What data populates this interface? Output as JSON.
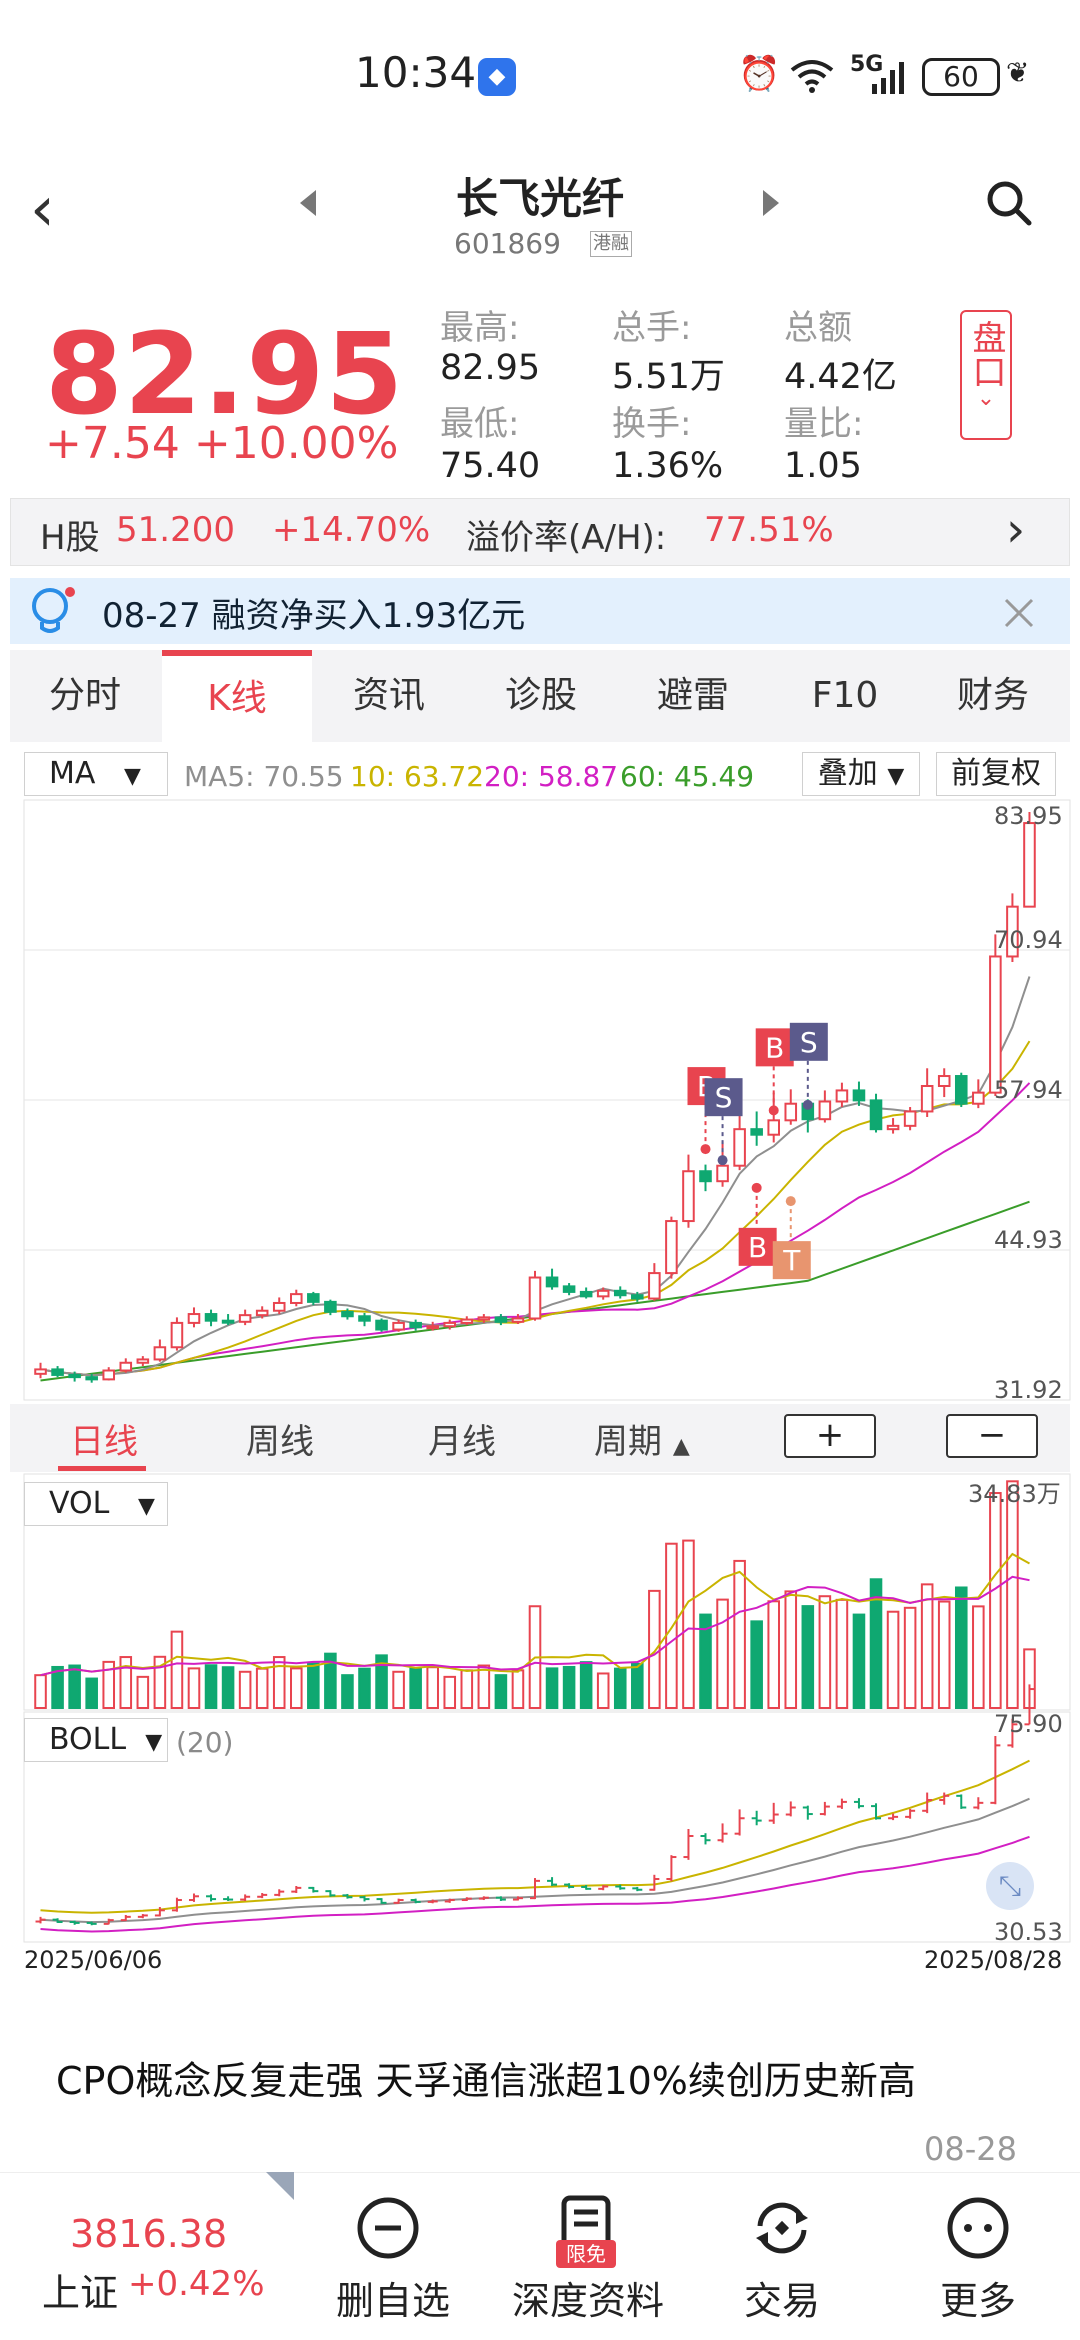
{
  "status_bar": {
    "time": "10:34",
    "right": "5G",
    "battery": "60"
  },
  "header": {
    "name": "长飞光纤",
    "code": "601869",
    "tag": "港融"
  },
  "quote": {
    "price": "82.95",
    "change": "+7.54",
    "change_pct": "+10.00%",
    "stats": [
      {
        "label": "最高:",
        "value": "82.95"
      },
      {
        "label": "总手:",
        "value": "5.51万"
      },
      {
        "label": "总额",
        "value": "4.42亿"
      },
      {
        "label": "最低:",
        "value": "75.40"
      },
      {
        "label": "换手:",
        "value": "1.36%"
      },
      {
        "label": "量比:",
        "value": "1.05"
      }
    ],
    "pankou": "盘口"
  },
  "hk": {
    "label": "H股",
    "price": "51.200",
    "pct": "+14.70%",
    "premium_label": "溢价率(A/H):",
    "premium_val": "77.51%"
  },
  "notice": {
    "text": "08-27 融资净买入1.93亿元"
  },
  "tabs": [
    "分时",
    "K线",
    "资讯",
    "诊股",
    "避雷",
    "F10",
    "财务"
  ],
  "indicator_bar": {
    "ma_select": "MA",
    "ma5": "MA5: 70.55",
    "ma10": "10: 63.72",
    "ma20": "20: 58.87",
    "ma60": "60: 45.49",
    "overlay": "叠加",
    "adjust": "前复权"
  },
  "chart_labels": {
    "ticks": [
      "83.95",
      "70.94",
      "57.94",
      "44.93",
      "31.92"
    ],
    "vol_select": "VOL",
    "vol_max": "34.83万",
    "boll_select": "BOLL",
    "boll_param": "(20)",
    "boll_top": "75.90",
    "boll_bottom": "30.53",
    "date_start": "2025/06/06",
    "date_end": "2025/08/28",
    "markers": {
      "b": "B",
      "s": "S",
      "t": "T"
    }
  },
  "periods": [
    "日线",
    "周线",
    "月线",
    "周期"
  ],
  "zoom": {
    "plus": "+",
    "minus": "−"
  },
  "news": {
    "title": "CPO概念反复走强 天孚通信涨超10%续创历史新高",
    "date": "08-28"
  },
  "bottom": {
    "index_value": "3816.38",
    "index_name": "上证",
    "index_change": "+0.42%",
    "items": [
      "删自选",
      "深度资料",
      "交易",
      "更多"
    ],
    "badge": "限免"
  },
  "colors": {
    "up": "#e8444f",
    "down": "#0fa871",
    "ma5": "#8f8f8f",
    "ma10": "#c9b400",
    "ma20": "#d21fc3",
    "ma60": "#3a9d2a"
  },
  "chart_data": {
    "type": "candlestick",
    "y_range": [
      31.92,
      83.95
    ],
    "x_range": [
      "2025/06/06",
      "2025/08/28"
    ],
    "candles": [
      {
        "o": 33.2,
        "c": 33.6,
        "h": 34.2,
        "l": 32.8
      },
      {
        "o": 33.6,
        "c": 33.1,
        "h": 33.9,
        "l": 32.9
      },
      {
        "o": 33.1,
        "c": 32.9,
        "h": 33.4,
        "l": 32.5
      },
      {
        "o": 32.9,
        "c": 32.7,
        "h": 33.2,
        "l": 32.4
      },
      {
        "o": 32.7,
        "c": 33.5,
        "h": 33.8,
        "l": 32.6
      },
      {
        "o": 33.5,
        "c": 34.2,
        "h": 34.6,
        "l": 33.3
      },
      {
        "o": 34.2,
        "c": 34.5,
        "h": 34.8,
        "l": 33.9
      },
      {
        "o": 34.5,
        "c": 35.6,
        "h": 36.3,
        "l": 34.3
      },
      {
        "o": 35.6,
        "c": 37.8,
        "h": 38.3,
        "l": 35.3
      },
      {
        "o": 37.8,
        "c": 38.6,
        "h": 39.2,
        "l": 37.4
      },
      {
        "o": 38.6,
        "c": 38.0,
        "h": 39.0,
        "l": 37.5
      },
      {
        "o": 38.0,
        "c": 37.9,
        "h": 38.6,
        "l": 37.6
      },
      {
        "o": 37.9,
        "c": 38.5,
        "h": 39.0,
        "l": 37.6
      },
      {
        "o": 38.5,
        "c": 38.9,
        "h": 39.3,
        "l": 38.2
      },
      {
        "o": 38.9,
        "c": 39.6,
        "h": 40.1,
        "l": 38.6
      },
      {
        "o": 39.6,
        "c": 40.4,
        "h": 40.8,
        "l": 39.3
      },
      {
        "o": 40.4,
        "c": 39.7,
        "h": 40.6,
        "l": 39.4
      },
      {
        "o": 39.7,
        "c": 38.8,
        "h": 39.9,
        "l": 38.5
      },
      {
        "o": 38.8,
        "c": 38.4,
        "h": 39.1,
        "l": 38.1
      },
      {
        "o": 38.4,
        "c": 38.0,
        "h": 38.7,
        "l": 37.5
      },
      {
        "o": 38.0,
        "c": 37.2,
        "h": 38.2,
        "l": 37.0
      },
      {
        "o": 37.2,
        "c": 37.8,
        "h": 38.1,
        "l": 37.0
      },
      {
        "o": 37.8,
        "c": 37.4,
        "h": 38.1,
        "l": 37.1
      },
      {
        "o": 37.4,
        "c": 37.5,
        "h": 37.9,
        "l": 37.1
      },
      {
        "o": 37.5,
        "c": 37.8,
        "h": 38.1,
        "l": 37.2
      },
      {
        "o": 37.8,
        "c": 38.1,
        "h": 38.4,
        "l": 37.6
      },
      {
        "o": 38.1,
        "c": 38.3,
        "h": 38.6,
        "l": 37.8
      },
      {
        "o": 38.3,
        "c": 37.9,
        "h": 38.6,
        "l": 37.6
      },
      {
        "o": 37.9,
        "c": 38.2,
        "h": 38.6,
        "l": 37.7
      },
      {
        "o": 38.2,
        "c": 41.9,
        "h": 42.5,
        "l": 38.0
      },
      {
        "o": 41.9,
        "c": 41.1,
        "h": 42.7,
        "l": 40.8
      },
      {
        "o": 41.1,
        "c": 40.6,
        "h": 41.4,
        "l": 40.3
      },
      {
        "o": 40.6,
        "c": 40.2,
        "h": 41.0,
        "l": 40.0
      },
      {
        "o": 40.2,
        "c": 40.7,
        "h": 41.0,
        "l": 39.9
      },
      {
        "o": 40.7,
        "c": 40.3,
        "h": 41.1,
        "l": 40.0
      },
      {
        "o": 40.3,
        "c": 40.0,
        "h": 40.6,
        "l": 39.7
      },
      {
        "o": 40.0,
        "c": 42.3,
        "h": 43.2,
        "l": 39.8
      },
      {
        "o": 42.3,
        "c": 47.0,
        "h": 47.4,
        "l": 41.8
      },
      {
        "o": 47.0,
        "c": 51.5,
        "h": 53.0,
        "l": 46.4
      },
      {
        "o": 51.5,
        "c": 50.6,
        "h": 52.1,
        "l": 49.7
      },
      {
        "o": 50.6,
        "c": 52.0,
        "h": 54.2,
        "l": 50.1
      },
      {
        "o": 52.0,
        "c": 55.3,
        "h": 57.2,
        "l": 51.6
      },
      {
        "o": 55.3,
        "c": 54.8,
        "h": 56.9,
        "l": 53.8
      },
      {
        "o": 54.8,
        "c": 56.1,
        "h": 58.6,
        "l": 54.1
      },
      {
        "o": 56.1,
        "c": 57.6,
        "h": 58.9,
        "l": 55.7
      },
      {
        "o": 57.6,
        "c": 56.2,
        "h": 58.0,
        "l": 55.0
      },
      {
        "o": 56.2,
        "c": 57.8,
        "h": 58.8,
        "l": 55.9
      },
      {
        "o": 57.8,
        "c": 58.8,
        "h": 59.5,
        "l": 57.3
      },
      {
        "o": 58.8,
        "c": 57.9,
        "h": 59.6,
        "l": 57.4
      },
      {
        "o": 57.9,
        "c": 55.3,
        "h": 58.5,
        "l": 55.0
      },
      {
        "o": 55.3,
        "c": 55.6,
        "h": 56.3,
        "l": 54.9
      },
      {
        "o": 55.6,
        "c": 56.9,
        "h": 57.3,
        "l": 55.2
      },
      {
        "o": 56.9,
        "c": 59.2,
        "h": 60.8,
        "l": 56.4
      },
      {
        "o": 59.2,
        "c": 60.1,
        "h": 60.8,
        "l": 58.2
      },
      {
        "o": 60.1,
        "c": 57.6,
        "h": 60.4,
        "l": 57.3
      },
      {
        "o": 57.6,
        "c": 58.6,
        "h": 59.8,
        "l": 57.2
      },
      {
        "o": 58.6,
        "c": 70.9,
        "h": 72.9,
        "l": 58.3
      },
      {
        "o": 70.9,
        "c": 75.4,
        "h": 76.6,
        "l": 70.4
      },
      {
        "o": 75.4,
        "c": 82.95,
        "h": 83.95,
        "l": 75.4
      }
    ],
    "ma5_last": 70.55,
    "ma10_last": 63.72,
    "ma20_last": 58.87,
    "ma60_last": 45.49,
    "volume_max": "34.83万",
    "boll_range": [
      30.53,
      75.9
    ]
  }
}
